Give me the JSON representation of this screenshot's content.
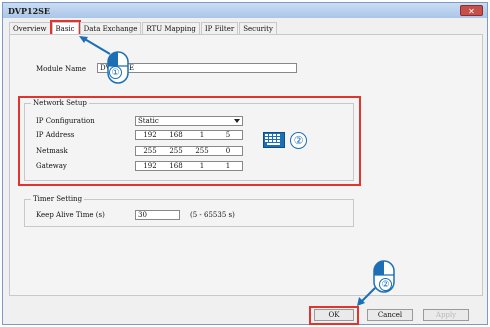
{
  "window": {
    "title": "DVP12SE",
    "close_glyph": "✕"
  },
  "tabs": [
    {
      "label": "Overview"
    },
    {
      "label": "Basic",
      "active": true
    },
    {
      "label": "Data Exchange"
    },
    {
      "label": "RTU Mapping"
    },
    {
      "label": "IP Filter"
    },
    {
      "label": "Security"
    }
  ],
  "module": {
    "label": "Module Name",
    "value": "DVP12SE"
  },
  "network": {
    "title": "Network Setup",
    "ip_config_label": "IP Configuration",
    "ip_config_value": "Static",
    "ip_address_label": "IP Address",
    "ip_address": [
      "192",
      "168",
      "1",
      "5"
    ],
    "netmask_label": "Netmask",
    "netmask": [
      "255",
      "255",
      "255",
      "0"
    ],
    "gateway_label": "Gateway",
    "gateway": [
      "192",
      "168",
      "1",
      "1"
    ]
  },
  "timer": {
    "title": "Timer Setting",
    "keep_alive_label": "Keep Alive Time (s)",
    "keep_alive_value": "30",
    "range_text": "(5 - 65535 s)"
  },
  "buttons": {
    "ok": "OK",
    "cancel": "Cancel",
    "apply": "Apply"
  },
  "annotations": {
    "step1": "①",
    "step2_keyboard": "②",
    "step2_ok": "②"
  },
  "icons": [
    "mouse-icon",
    "keyboard-icon",
    "close-icon",
    "chevron-down-icon"
  ],
  "colors": {
    "highlight": "#e0342e",
    "callout": "#1c6fb5"
  }
}
